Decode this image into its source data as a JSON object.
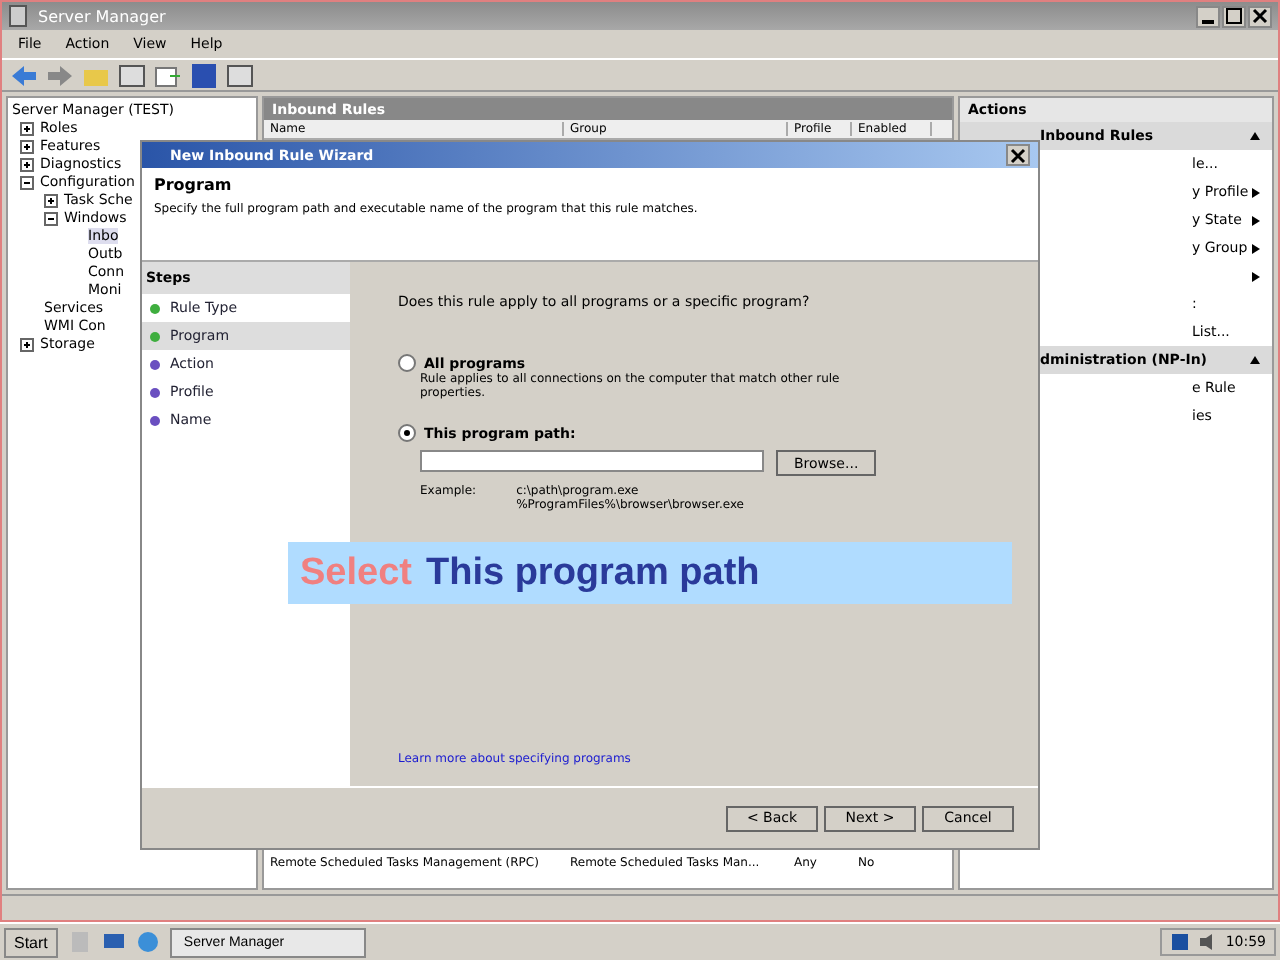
{
  "window": {
    "title": "Server Manager"
  },
  "menu": [
    "File",
    "Action",
    "View",
    "Help"
  ],
  "tree": [
    {
      "label": "Server Manager (TEST)",
      "children": [
        {
          "label": "Roles",
          "expanded": false
        },
        {
          "label": "Features",
          "expanded": false
        },
        {
          "label": "Diagnostics",
          "expanded": false
        },
        {
          "label": "Configuration",
          "expanded": true,
          "children": [
            {
              "label": "Task Sche",
              "expanded": false
            },
            {
              "label": "Windows",
              "expanded": true,
              "children": [
                {
                  "label": "Inbo",
                  "selected": true
                },
                {
                  "label": "Outb",
                  "selected": false
                },
                {
                  "label": "Conn",
                  "selected": false
                },
                {
                  "label": "Moni",
                  "selected": false
                }
              ]
            },
            {
              "label": "Services"
            },
            {
              "label": "WMI Con"
            }
          ]
        },
        {
          "label": "Storage",
          "expanded": false
        }
      ]
    }
  ],
  "middle": {
    "title": "Inbound Rules",
    "columns": [
      "Name",
      "Group",
      "Profile",
      "Enabled"
    ],
    "rows": [
      {
        "cells": [
          "Remote Scheduled Tasks Management (RPC)",
          "Remote Scheduled Tasks Man...",
          "Any",
          "No"
        ]
      }
    ]
  },
  "actions": {
    "title": "Actions",
    "sections": [
      {
        "title": "Inbound Rules",
        "items": [
          {
            "label": "le...",
            "submenu": false
          },
          {
            "label": "y Profile",
            "submenu": true
          },
          {
            "label": "y State",
            "submenu": true
          },
          {
            "label": "y Group",
            "submenu": true
          },
          {
            "submenu": true
          },
          {
            "label": ":",
            "submenu": false
          },
          {
            "label": "List...",
            "submenu": false
          }
        ]
      },
      {
        "title": "dministration (NP-In)",
        "items": [
          {
            "label": "e Rule",
            "submenu": false
          },
          {
            "label": "ies",
            "submenu": false
          }
        ]
      }
    ]
  },
  "dialog": {
    "title": "New Inbound Rule Wizard",
    "heading": "Program",
    "subheading": "Specify the full program path and executable name of the program that this rule matches.",
    "steps_title": "Steps",
    "steps": [
      {
        "label": "Rule Type",
        "selected": false,
        "color": "#3fae3f"
      },
      {
        "label": "Program",
        "selected": true,
        "color": "#3fae3f"
      },
      {
        "label": "Action",
        "selected": false,
        "color": "#6a4fc0"
      },
      {
        "label": "Profile",
        "selected": false,
        "color": "#6a4fc0"
      },
      {
        "label": "Name",
        "selected": false,
        "color": "#6a4fc0"
      }
    ],
    "question": "Does this rule apply to all programs or a specific program?",
    "options": [
      {
        "label": "All programs",
        "description": "Rule applies to all connections on the computer that match other rule properties.",
        "selected": false
      },
      {
        "label": "This program path:",
        "selected": true
      }
    ],
    "browse": "Browse...",
    "example_label": "Example:",
    "examples": [
      "c:\\path\\program.exe",
      "%ProgramFiles%\\browser\\browser.exe"
    ],
    "link": "Learn more about specifying programs",
    "buttons": [
      "< Back",
      "Next >",
      "Cancel"
    ]
  },
  "caption": {
    "verb": "Select",
    "target": "This program path"
  },
  "taskbar": {
    "start": "Start",
    "tasks": [
      "Server Manager"
    ],
    "clock": "10:59"
  }
}
